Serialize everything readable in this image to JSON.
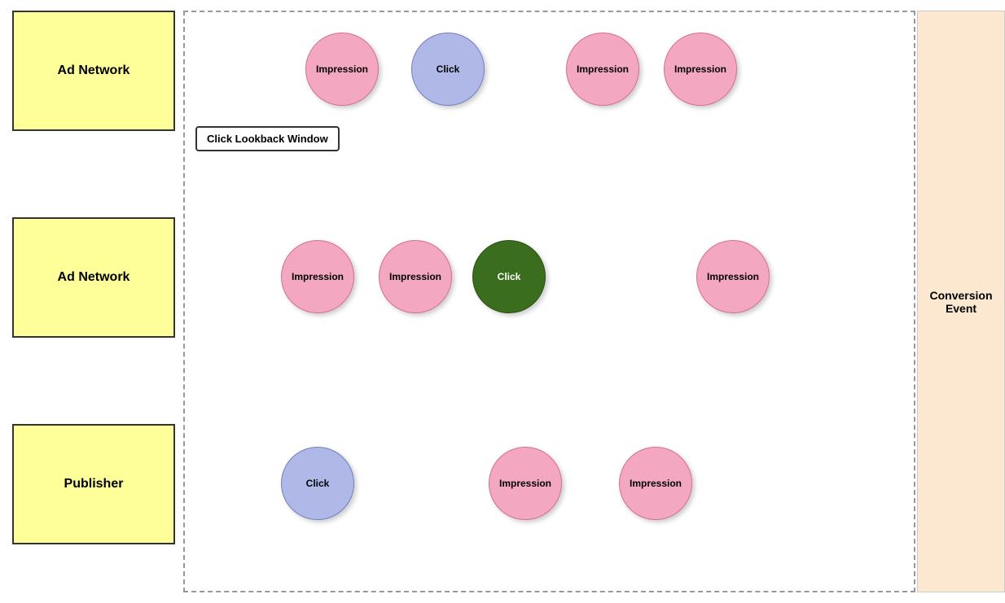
{
  "actors": {
    "ad_network_1": {
      "label": "Ad Network"
    },
    "ad_network_2": {
      "label": "Ad Network"
    },
    "publisher": {
      "label": "Publisher"
    }
  },
  "conversion_panel": {
    "label": "Conversion\nEvent"
  },
  "lookback": {
    "label": "Click Lookback\nWindow"
  },
  "circles": {
    "row1": {
      "imp1": {
        "label": "Impression"
      },
      "click": {
        "label": "Click"
      },
      "imp3": {
        "label": "Impression"
      },
      "imp4": {
        "label": "Impression"
      }
    },
    "row2": {
      "imp1": {
        "label": "Impression"
      },
      "imp2": {
        "label": "Impression"
      },
      "click": {
        "label": "Click"
      },
      "imp4": {
        "label": "Impression"
      }
    },
    "row3": {
      "click": {
        "label": "Click"
      },
      "imp2": {
        "label": "Impression"
      },
      "imp3": {
        "label": "Impression"
      }
    }
  }
}
